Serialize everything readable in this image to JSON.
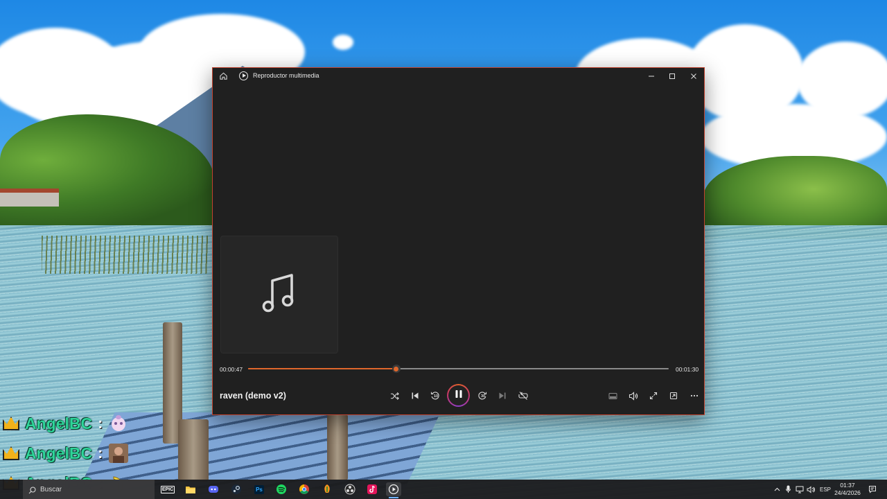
{
  "window": {
    "title": "Reproductor multimedia",
    "accent_color": "#e0672c",
    "border_color": "#c2432f"
  },
  "player": {
    "current_time": "00:00:47",
    "total_time": "00:01:30",
    "progress_fraction": 0.352,
    "track_title": "raven (demo v2)",
    "skip_back_seconds": "10",
    "skip_forward_seconds": "30"
  },
  "chat": {
    "messages": [
      {
        "username": "AngelBC",
        "separator": ":"
      },
      {
        "username": "AngelBC",
        "separator": ":"
      },
      {
        "username": "AngelBC",
        "separator": ":"
      }
    ],
    "username_color": "#2fd49a"
  },
  "taskbar": {
    "search_placeholder": "Buscar",
    "epic_label": "EPIC",
    "photoshop_label": "Ps",
    "language": "ESP",
    "time": "01:37",
    "date": "24/4/2026"
  }
}
